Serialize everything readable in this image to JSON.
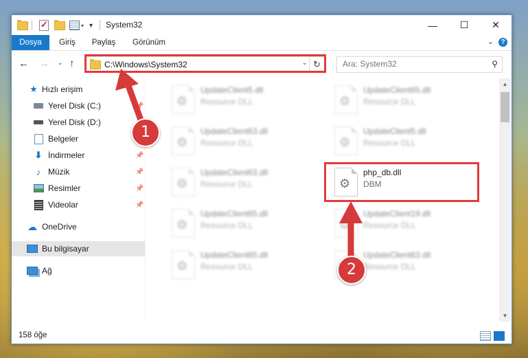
{
  "window": {
    "title": "System32",
    "controls": {
      "minimize": "—",
      "maximize": "☐",
      "close": "✕"
    }
  },
  "ribbon": {
    "tabs": [
      "Dosya",
      "Giriş",
      "Paylaş",
      "Görünüm"
    ]
  },
  "navigation": {
    "address": "C:\\Windows\\System32",
    "search_placeholder": "Ara: System32"
  },
  "sidebar": {
    "items": [
      {
        "label": "Hızlı erişim",
        "icon": "star-icon"
      },
      {
        "label": "Yerel Disk (C:)",
        "icon": "drive-icon",
        "pinned": true
      },
      {
        "label": "Yerel Disk (D:)",
        "icon": "drive-icon"
      },
      {
        "label": "Belgeler",
        "icon": "documents-icon"
      },
      {
        "label": "İndirmeler",
        "icon": "download-icon",
        "pinned": true
      },
      {
        "label": "Müzik",
        "icon": "music-icon",
        "pinned": true
      },
      {
        "label": "Resimler",
        "icon": "pictures-icon",
        "pinned": true
      },
      {
        "label": "Videolar",
        "icon": "videos-icon",
        "pinned": true
      },
      {
        "label": "OneDrive",
        "icon": "cloud-icon"
      },
      {
        "label": "Bu bilgisayar",
        "icon": "computer-icon",
        "selected": true
      },
      {
        "label": "Ağ",
        "icon": "network-icon"
      }
    ],
    "pin_glyph": "📌"
  },
  "files": [
    {
      "name": "UpdateClient5.dll",
      "type": "Resource DLL"
    },
    {
      "name": "UpdateClient65.dll",
      "type": "Resource DLL"
    },
    {
      "name": "UpdateClient63.dll",
      "type": "Resource DLL"
    },
    {
      "name": "UpdateClient5.dll",
      "type": "Resource DLL"
    },
    {
      "name": "UpdateClient63.dll",
      "type": "Resource DLL"
    },
    {
      "name": "php_db.dll",
      "type": "DBM",
      "highlighted": true
    },
    {
      "name": "UpdateClient65.dll",
      "type": "Resource DLL"
    },
    {
      "name": "UpdateClient19.dll",
      "type": "Resource DLL"
    },
    {
      "name": "UpdateClient65.dll",
      "type": "Resource DLL"
    },
    {
      "name": "UpdateClient63.dll",
      "type": "Resource DLL"
    }
  ],
  "status": {
    "item_count": "158 öğe"
  },
  "annotations": {
    "marker1": "1",
    "marker2": "2",
    "accent_color": "#e23a3a"
  }
}
